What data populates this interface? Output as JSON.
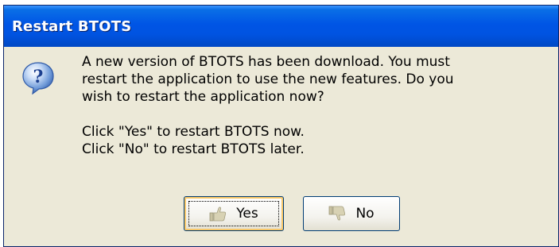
{
  "window": {
    "title": "Restart BTOTS"
  },
  "dialog": {
    "icon": "question-icon",
    "message_lines": [
      "A new version of BTOTS has been download. You must",
      "restart the application to use the new features. Do you",
      "wish to restart the application now?"
    ],
    "instruction_lines": [
      "Click \"Yes\" to restart BTOTS now.",
      "Click \"No\" to restart BTOTS later."
    ]
  },
  "buttons": {
    "yes": {
      "label": "Yes",
      "icon": "thumbs-up-icon"
    },
    "no": {
      "label": "No",
      "icon": "thumbs-down-icon"
    }
  },
  "colors": {
    "titlebar": "#0055e5",
    "dialog_bg": "#ece9d8",
    "button_border": "#003c74"
  }
}
